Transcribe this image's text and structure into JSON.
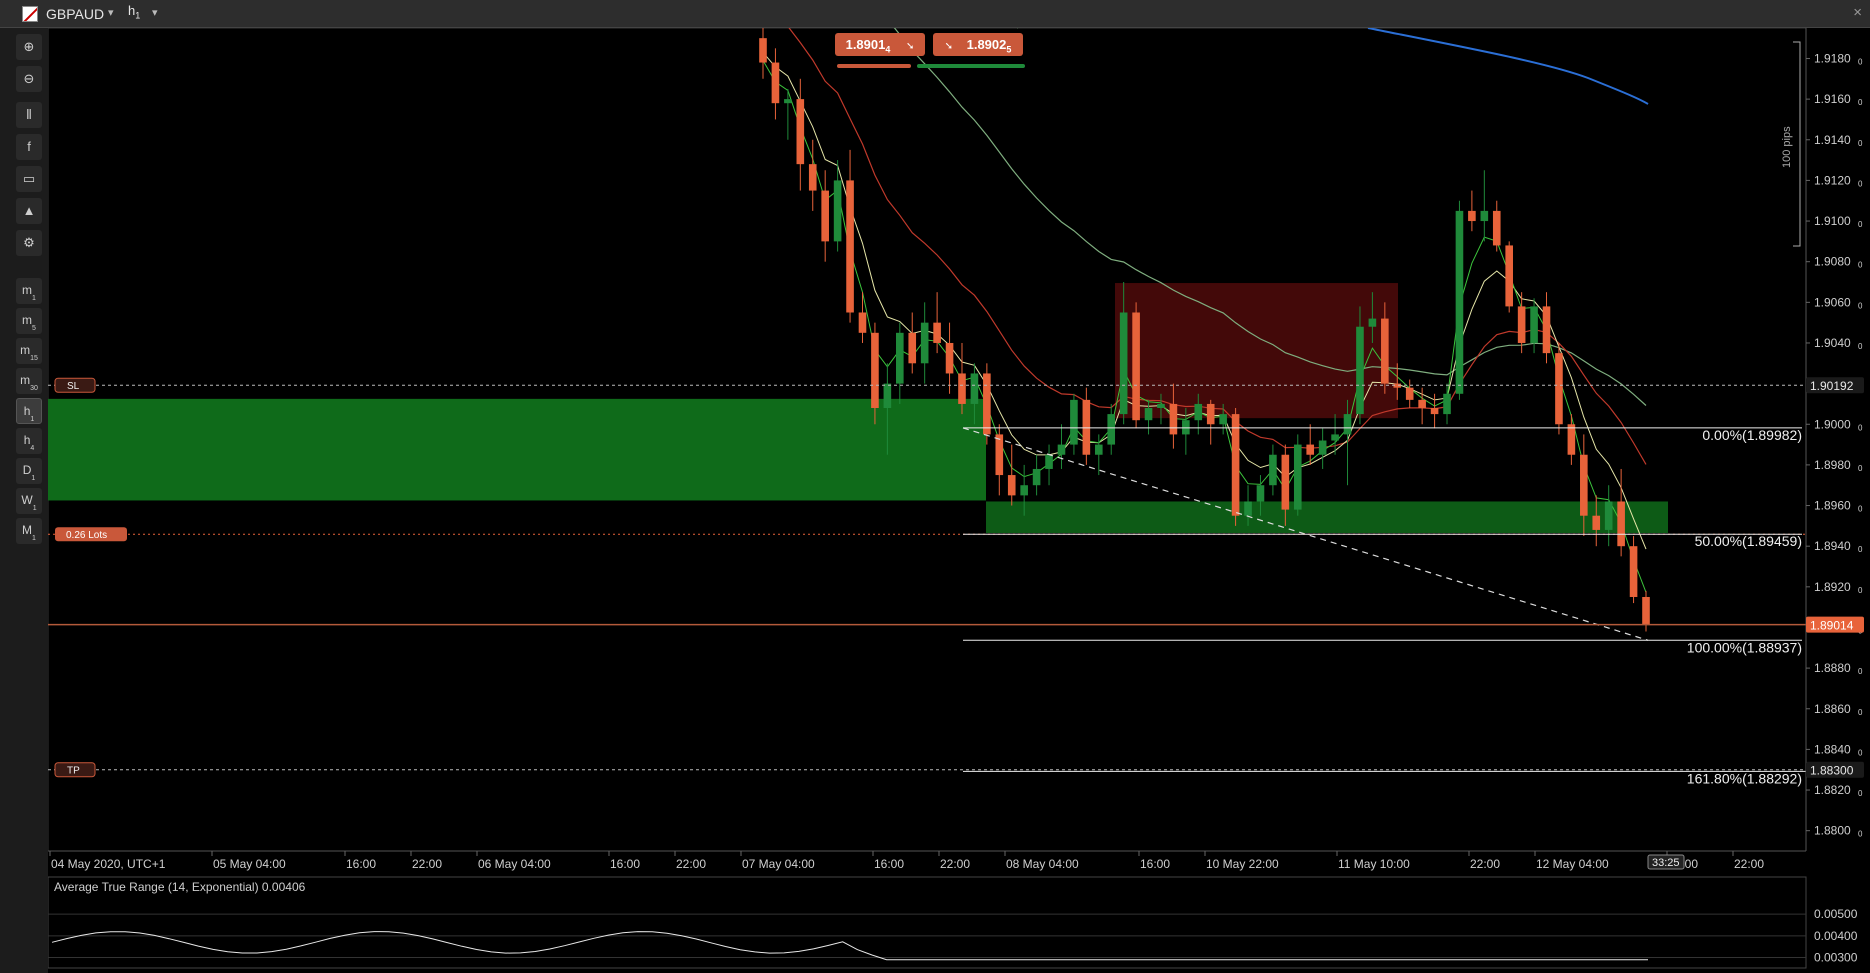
{
  "symbol": "GBPAUD",
  "timeframe": "h",
  "timeframe_sub": "1",
  "close_label": "×",
  "sidebar_tools": [
    {
      "icon": "zoom-in-icon",
      "glyph": "⊕"
    },
    {
      "icon": "zoom-out-icon",
      "glyph": "⊖"
    },
    {
      "icon": "candlestick-icon",
      "glyph": "⫴"
    },
    {
      "icon": "facebook-icon",
      "glyph": "f"
    },
    {
      "icon": "robot-icon",
      "glyph": "▭"
    },
    {
      "icon": "shapes-icon",
      "glyph": "▲"
    },
    {
      "icon": "settings-icon",
      "glyph": "⚙"
    }
  ],
  "timeframes": [
    {
      "label": "m",
      "sub": "1"
    },
    {
      "label": "m",
      "sub": "5"
    },
    {
      "label": "m",
      "sub": "15"
    },
    {
      "label": "m",
      "sub": "30"
    },
    {
      "label": "h",
      "sub": "1"
    },
    {
      "label": "h",
      "sub": "4"
    },
    {
      "label": "D",
      "sub": "1"
    },
    {
      "label": "W",
      "sub": "1"
    },
    {
      "label": "M",
      "sub": "1"
    }
  ],
  "active_timeframe_index": 4,
  "quote": {
    "sell_main": "1.8901",
    "sell_pip": "4",
    "buy_main": "1.8902",
    "buy_pip": "5",
    "sell_icon": "sell-arrow-icon",
    "buy_icon": "buy-arrow-icon"
  },
  "price_axis": {
    "labels": [
      "1.9180",
      "1.9160",
      "1.9140",
      "1.9120",
      "1.9100",
      "1.9080",
      "1.9060",
      "1.9040",
      "1.9020",
      "1.9000",
      "1.8980",
      "1.8960",
      "1.8940",
      "1.8920",
      "1.8900",
      "1.8880",
      "1.8860",
      "1.8840",
      "1.8820",
      "1.8800"
    ],
    "label_suffix": "0",
    "values": [
      1.918,
      1.916,
      1.914,
      1.912,
      1.91,
      1.908,
      1.906,
      1.904,
      1.902,
      1.9,
      1.898,
      1.896,
      1.894,
      1.892,
      1.89,
      1.888,
      1.886,
      1.884,
      1.882,
      1.88
    ],
    "current_price": "1.89014",
    "sl_price": "1.90192",
    "tp_price": "1.88300",
    "pips_label": "100 pips"
  },
  "time_axis": {
    "labels": [
      "04 May 2020, UTC+1",
      "05 May 04:00",
      "16:00",
      "22:00",
      "06 May 04:00",
      "16:00",
      "22:00",
      "07 May 04:00",
      "16:00",
      "22:00",
      "08 May 04:00",
      "16:00",
      "10 May 22:00",
      "11 May 10:00",
      "22:00",
      "12 May 04:00",
      "16:00",
      "22:00"
    ],
    "countdown": "33:25"
  },
  "orders": {
    "sl_label": "SL",
    "tp_label": "TP",
    "lots_label": "0.26 Lots"
  },
  "fibonacci": [
    {
      "label": "0.00%(1.89982)",
      "price": 1.89982
    },
    {
      "label": "50.00%(1.89459)",
      "price": 1.89459
    },
    {
      "label": "100.00%(1.88937)",
      "price": 1.88937
    },
    {
      "label": "161.80%(1.88292)",
      "price": 1.88292
    }
  ],
  "indicator": {
    "title": "Average True Range (14, Exponential) 0.00406",
    "labels": [
      "0.00500",
      "0.00400",
      "0.00300"
    ],
    "values": [
      0.005,
      0.004,
      0.003
    ]
  },
  "colors": {
    "bull": "#1f8a3a",
    "bear": "#e8633a",
    "zone_green": "#0f6b1a",
    "zone_red": "#4a0a0a",
    "ma_blue": "#2b6fd6",
    "ma_red": "#c0392b",
    "ma_lightgreen": "#7fae7f",
    "ma_yellow": "#e6e6a8",
    "ma_green": "#3cc43c",
    "current_price_badge": "#e8633a",
    "sl_tp_badge": "#2b2b2b"
  },
  "chart_data": {
    "type": "candlestick",
    "symbol": "GBPAUD",
    "timeframe": "H1",
    "ylim": [
      1.879,
      1.9195
    ],
    "current_price": 1.89014,
    "stop_loss": 1.90192,
    "take_profit": 1.883,
    "position_lots": 0.26,
    "candles": [
      [
        1.919,
        1.9195,
        1.917,
        1.9178
      ],
      [
        1.9178,
        1.9185,
        1.915,
        1.9158
      ],
      [
        1.9158,
        1.9165,
        1.914,
        1.916
      ],
      [
        1.916,
        1.917,
        1.9115,
        1.9128
      ],
      [
        1.9128,
        1.914,
        1.9105,
        1.9115
      ],
      [
        1.9115,
        1.9125,
        1.908,
        1.909
      ],
      [
        1.909,
        1.913,
        1.9085,
        1.912
      ],
      [
        1.912,
        1.9135,
        1.905,
        1.9055
      ],
      [
        1.9055,
        1.9065,
        1.904,
        1.9045
      ],
      [
        1.9045,
        1.905,
        1.9,
        1.9008
      ],
      [
        1.9008,
        1.903,
        1.8985,
        1.902
      ],
      [
        1.902,
        1.905,
        1.901,
        1.9045
      ],
      [
        1.9045,
        1.9055,
        1.9025,
        1.903
      ],
      [
        1.903,
        1.906,
        1.902,
        1.905
      ],
      [
        1.905,
        1.9065,
        1.9035,
        1.904
      ],
      [
        1.904,
        1.905,
        1.9015,
        1.9025
      ],
      [
        1.9025,
        1.904,
        1.9005,
        1.901
      ],
      [
        1.901,
        1.903,
        1.9,
        1.9025
      ],
      [
        1.9025,
        1.903,
        1.899,
        1.8995
      ],
      [
        1.8995,
        1.9,
        1.8965,
        1.8975
      ],
      [
        1.8975,
        1.899,
        1.896,
        1.8965
      ],
      [
        1.8965,
        1.898,
        1.8955,
        1.897
      ],
      [
        1.897,
        1.8985,
        1.8965,
        1.8978
      ],
      [
        1.8978,
        1.899,
        1.897,
        1.8985
      ],
      [
        1.8985,
        1.9,
        1.8978,
        1.899
      ],
      [
        1.899,
        1.9015,
        1.8985,
        1.9012
      ],
      [
        1.9012,
        1.9018,
        1.898,
        1.8985
      ],
      [
        1.8985,
        1.8995,
        1.8975,
        1.899
      ],
      [
        1.899,
        1.901,
        1.8985,
        1.9005
      ],
      [
        1.9005,
        1.907,
        1.9,
        1.9055
      ],
      [
        1.9055,
        1.906,
        1.8998,
        1.9002
      ],
      [
        1.9002,
        1.9012,
        1.8995,
        1.9008
      ],
      [
        1.9008,
        1.9015,
        1.9,
        1.901
      ],
      [
        1.901,
        1.902,
        1.8988,
        1.8995
      ],
      [
        1.8995,
        1.9008,
        1.8985,
        1.9002
      ],
      [
        1.9002,
        1.9015,
        1.8995,
        1.901
      ],
      [
        1.901,
        1.9012,
        1.899,
        1.9
      ],
      [
        1.9,
        1.901,
        1.8995,
        1.9005
      ],
      [
        1.9005,
        1.9008,
        1.895,
        1.8955
      ],
      [
        1.8955,
        1.897,
        1.895,
        1.8962
      ],
      [
        1.8962,
        1.8975,
        1.8955,
        1.897
      ],
      [
        1.897,
        1.899,
        1.8965,
        1.8985
      ],
      [
        1.8985,
        1.899,
        1.895,
        1.8958
      ],
      [
        1.8958,
        1.8995,
        1.8955,
        1.899
      ],
      [
        1.899,
        1.9,
        1.898,
        1.8985
      ],
      [
        1.8985,
        1.8998,
        1.8978,
        1.8992
      ],
      [
        1.8992,
        1.9005,
        1.8985,
        1.8995
      ],
      [
        1.8995,
        1.9012,
        1.897,
        1.9005
      ],
      [
        1.9005,
        1.9058,
        1.9,
        1.9048
      ],
      [
        1.9048,
        1.9065,
        1.904,
        1.9052
      ],
      [
        1.9052,
        1.906,
        1.9015,
        1.902
      ],
      [
        1.902,
        1.903,
        1.9012,
        1.9018
      ],
      [
        1.9018,
        1.9022,
        1.9008,
        1.9012
      ],
      [
        1.9012,
        1.9018,
        1.9,
        1.9008
      ],
      [
        1.9008,
        1.9015,
        1.8998,
        1.9005
      ],
      [
        1.9005,
        1.902,
        1.9,
        1.9015
      ],
      [
        1.9015,
        1.911,
        1.9012,
        1.9105
      ],
      [
        1.9105,
        1.9115,
        1.9095,
        1.91
      ],
      [
        1.91,
        1.9125,
        1.909,
        1.9105
      ],
      [
        1.9105,
        1.911,
        1.9085,
        1.9088
      ],
      [
        1.9088,
        1.909,
        1.9055,
        1.9058
      ],
      [
        1.9058,
        1.9065,
        1.9035,
        1.904
      ],
      [
        1.904,
        1.9062,
        1.9035,
        1.9058
      ],
      [
        1.9058,
        1.9065,
        1.903,
        1.9035
      ],
      [
        1.9035,
        1.904,
        1.8995,
        1.9
      ],
      [
        1.9,
        1.9005,
        1.898,
        1.8985
      ],
      [
        1.8985,
        1.8995,
        1.8945,
        1.8955
      ],
      [
        1.8955,
        1.8965,
        1.894,
        1.8948
      ],
      [
        1.8948,
        1.897,
        1.894,
        1.8962
      ],
      [
        1.8962,
        1.8978,
        1.8935,
        1.894
      ],
      [
        1.894,
        1.8945,
        1.8912,
        1.8915
      ],
      [
        1.8915,
        1.8918,
        1.8898,
        1.89014
      ]
    ]
  }
}
